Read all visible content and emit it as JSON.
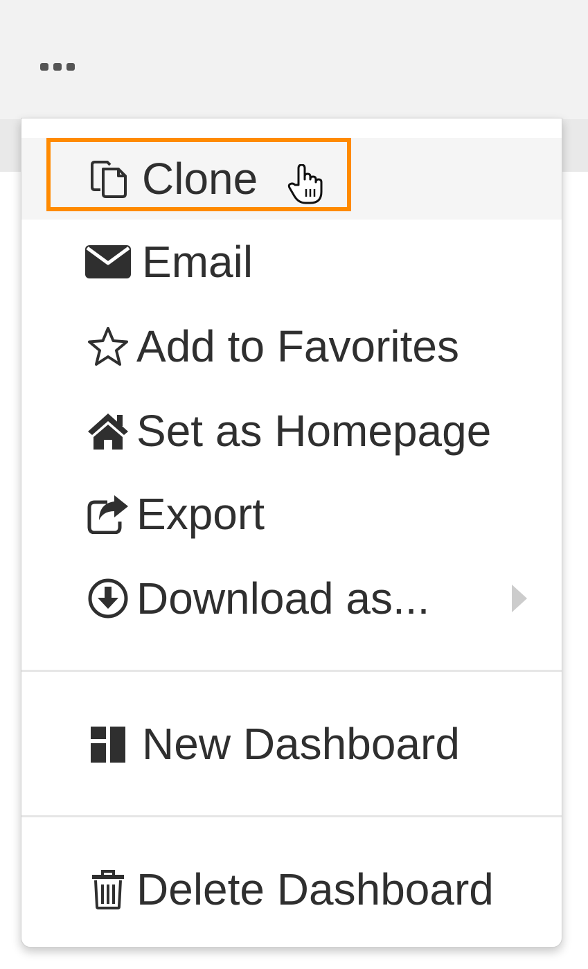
{
  "toolbar": {
    "more_icon": "ellipsis-icon"
  },
  "menu": {
    "items": [
      {
        "label": "Clone",
        "icon": "clone-icon",
        "hovered": true
      },
      {
        "label": "Email",
        "icon": "envelope-icon"
      },
      {
        "label": "Add to Favorites",
        "icon": "star-outline-icon"
      },
      {
        "label": "Set as Homepage",
        "icon": "home-icon"
      },
      {
        "label": "Export",
        "icon": "share-export-icon"
      },
      {
        "label": "Download as...",
        "icon": "download-circle-icon",
        "submenu_icon": "chevron-right-icon"
      },
      {
        "label": "New Dashboard",
        "icon": "dashboard-icon"
      },
      {
        "label": "Delete Dashboard",
        "icon": "trash-icon"
      }
    ]
  },
  "colors": {
    "highlight": "#ff8a00",
    "text": "#2f2f2f",
    "hover_bg": "#f5f5f5",
    "toolbar_bg": "#f2f2f2"
  }
}
